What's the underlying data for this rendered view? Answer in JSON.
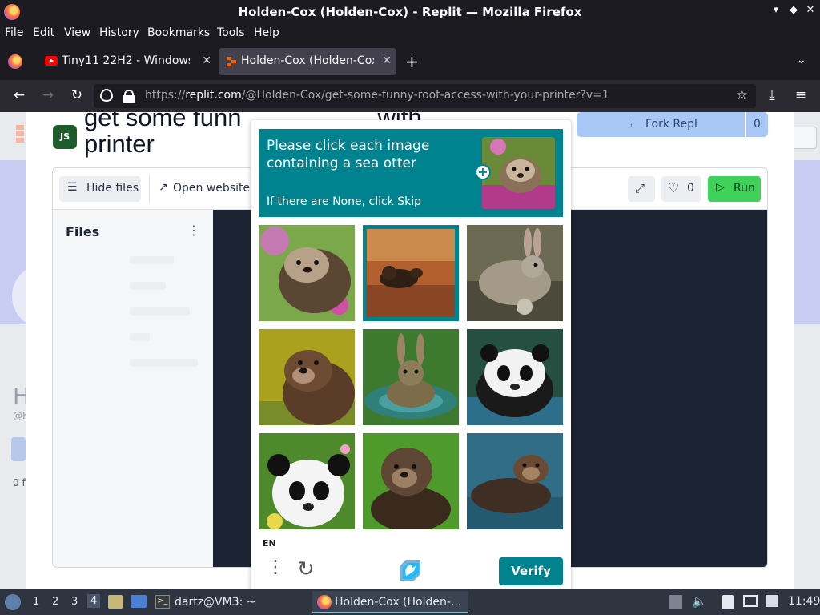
{
  "window": {
    "title": "Holden-Cox (Holden-Cox) - Replit — Mozilla Firefox"
  },
  "menubar": [
    "File",
    "Edit",
    "View",
    "History",
    "Bookmarks",
    "Tools",
    "Help"
  ],
  "tabs": [
    {
      "label": "Tiny11 22H2 - Windows 1",
      "icon": "youtube-icon",
      "active": false
    },
    {
      "label": "Holden-Cox (Holden-Cox",
      "icon": "replit-icon",
      "active": true
    }
  ],
  "urlbar": {
    "scheme": "https://",
    "host": "replit.com",
    "path": "/@Holden-Cox/get-some-funny-root-access-with-your-printer?v=1"
  },
  "repl": {
    "title_line1": "get some funn",
    "title_line1_tail": "with",
    "title_line2": "printer",
    "icon_text": "JS",
    "fork_label": "Fork Repl",
    "fork_count": "0",
    "hide_files": "Hide files",
    "open_website": "Open website",
    "likes": "0",
    "run": "Run",
    "files_header": "Files",
    "ghost_letter": "H",
    "ghost_handle": "@F",
    "ghost_count": "0 f"
  },
  "captcha": {
    "prompt": "Please click each image containing a sea otter",
    "hint": "If there are None, click Skip",
    "language": "EN",
    "verify": "Verify",
    "tiles": [
      {
        "subject": "sea otter",
        "selected": false
      },
      {
        "subject": "sea otter",
        "selected": true
      },
      {
        "subject": "rabbit",
        "selected": false
      },
      {
        "subject": "sea otter",
        "selected": false
      },
      {
        "subject": "rabbit",
        "selected": false
      },
      {
        "subject": "panda",
        "selected": false
      },
      {
        "subject": "panda",
        "selected": false
      },
      {
        "subject": "sea otter",
        "selected": false
      },
      {
        "subject": "sea otter",
        "selected": false
      }
    ],
    "accent": "#00838f"
  },
  "taskbar": {
    "workspaces": [
      "1",
      "2",
      "3",
      "4"
    ],
    "terminal_label": "dartz@VM3: ~",
    "firefox_task": "Holden-Cox (Holden-...",
    "clock": "11:49"
  }
}
